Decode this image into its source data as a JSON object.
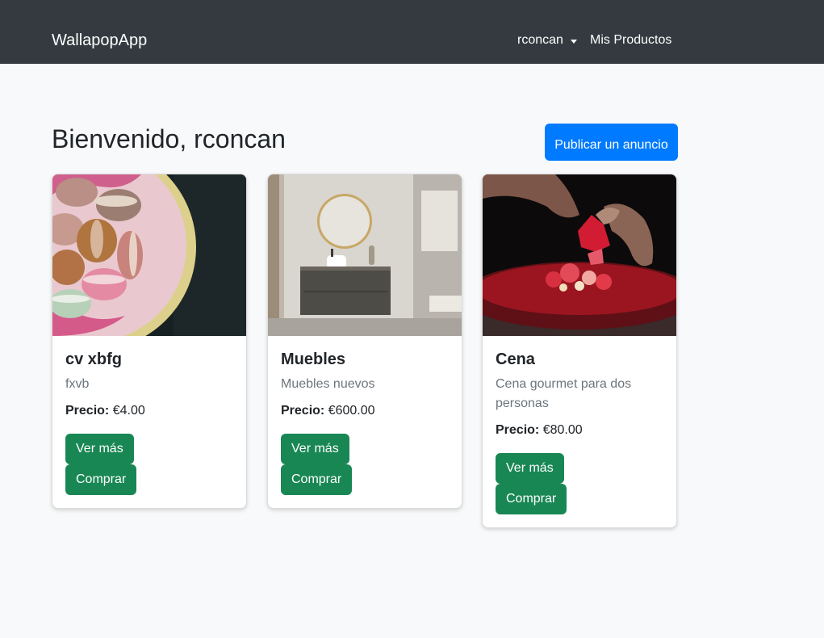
{
  "navbar": {
    "brand": "WallapopApp",
    "user": "rconcan",
    "my_products": "Mis Productos"
  },
  "header": {
    "welcome": "Bienvenido, rconcan",
    "publish_label": "Publicar un anuncio"
  },
  "products": [
    {
      "title": "cv xbfg",
      "description": "fxvb",
      "price_label": "Precio:",
      "price": "€4.00",
      "more_label": "Ver más",
      "buy_label": "Comprar"
    },
    {
      "title": "Muebles",
      "description": "Muebles nuevos",
      "price_label": "Precio:",
      "price": "€600.00",
      "more_label": "Ver más",
      "buy_label": "Comprar"
    },
    {
      "title": "Cena",
      "description": "Cena gourmet para dos personas",
      "price_label": "Precio:",
      "price": "€80.00",
      "more_label": "Ver más",
      "buy_label": "Comprar"
    }
  ],
  "colors": {
    "navbar_bg": "#343a40",
    "primary": "#007bff",
    "success": "#198754",
    "page_bg": "#f8f9fa"
  }
}
